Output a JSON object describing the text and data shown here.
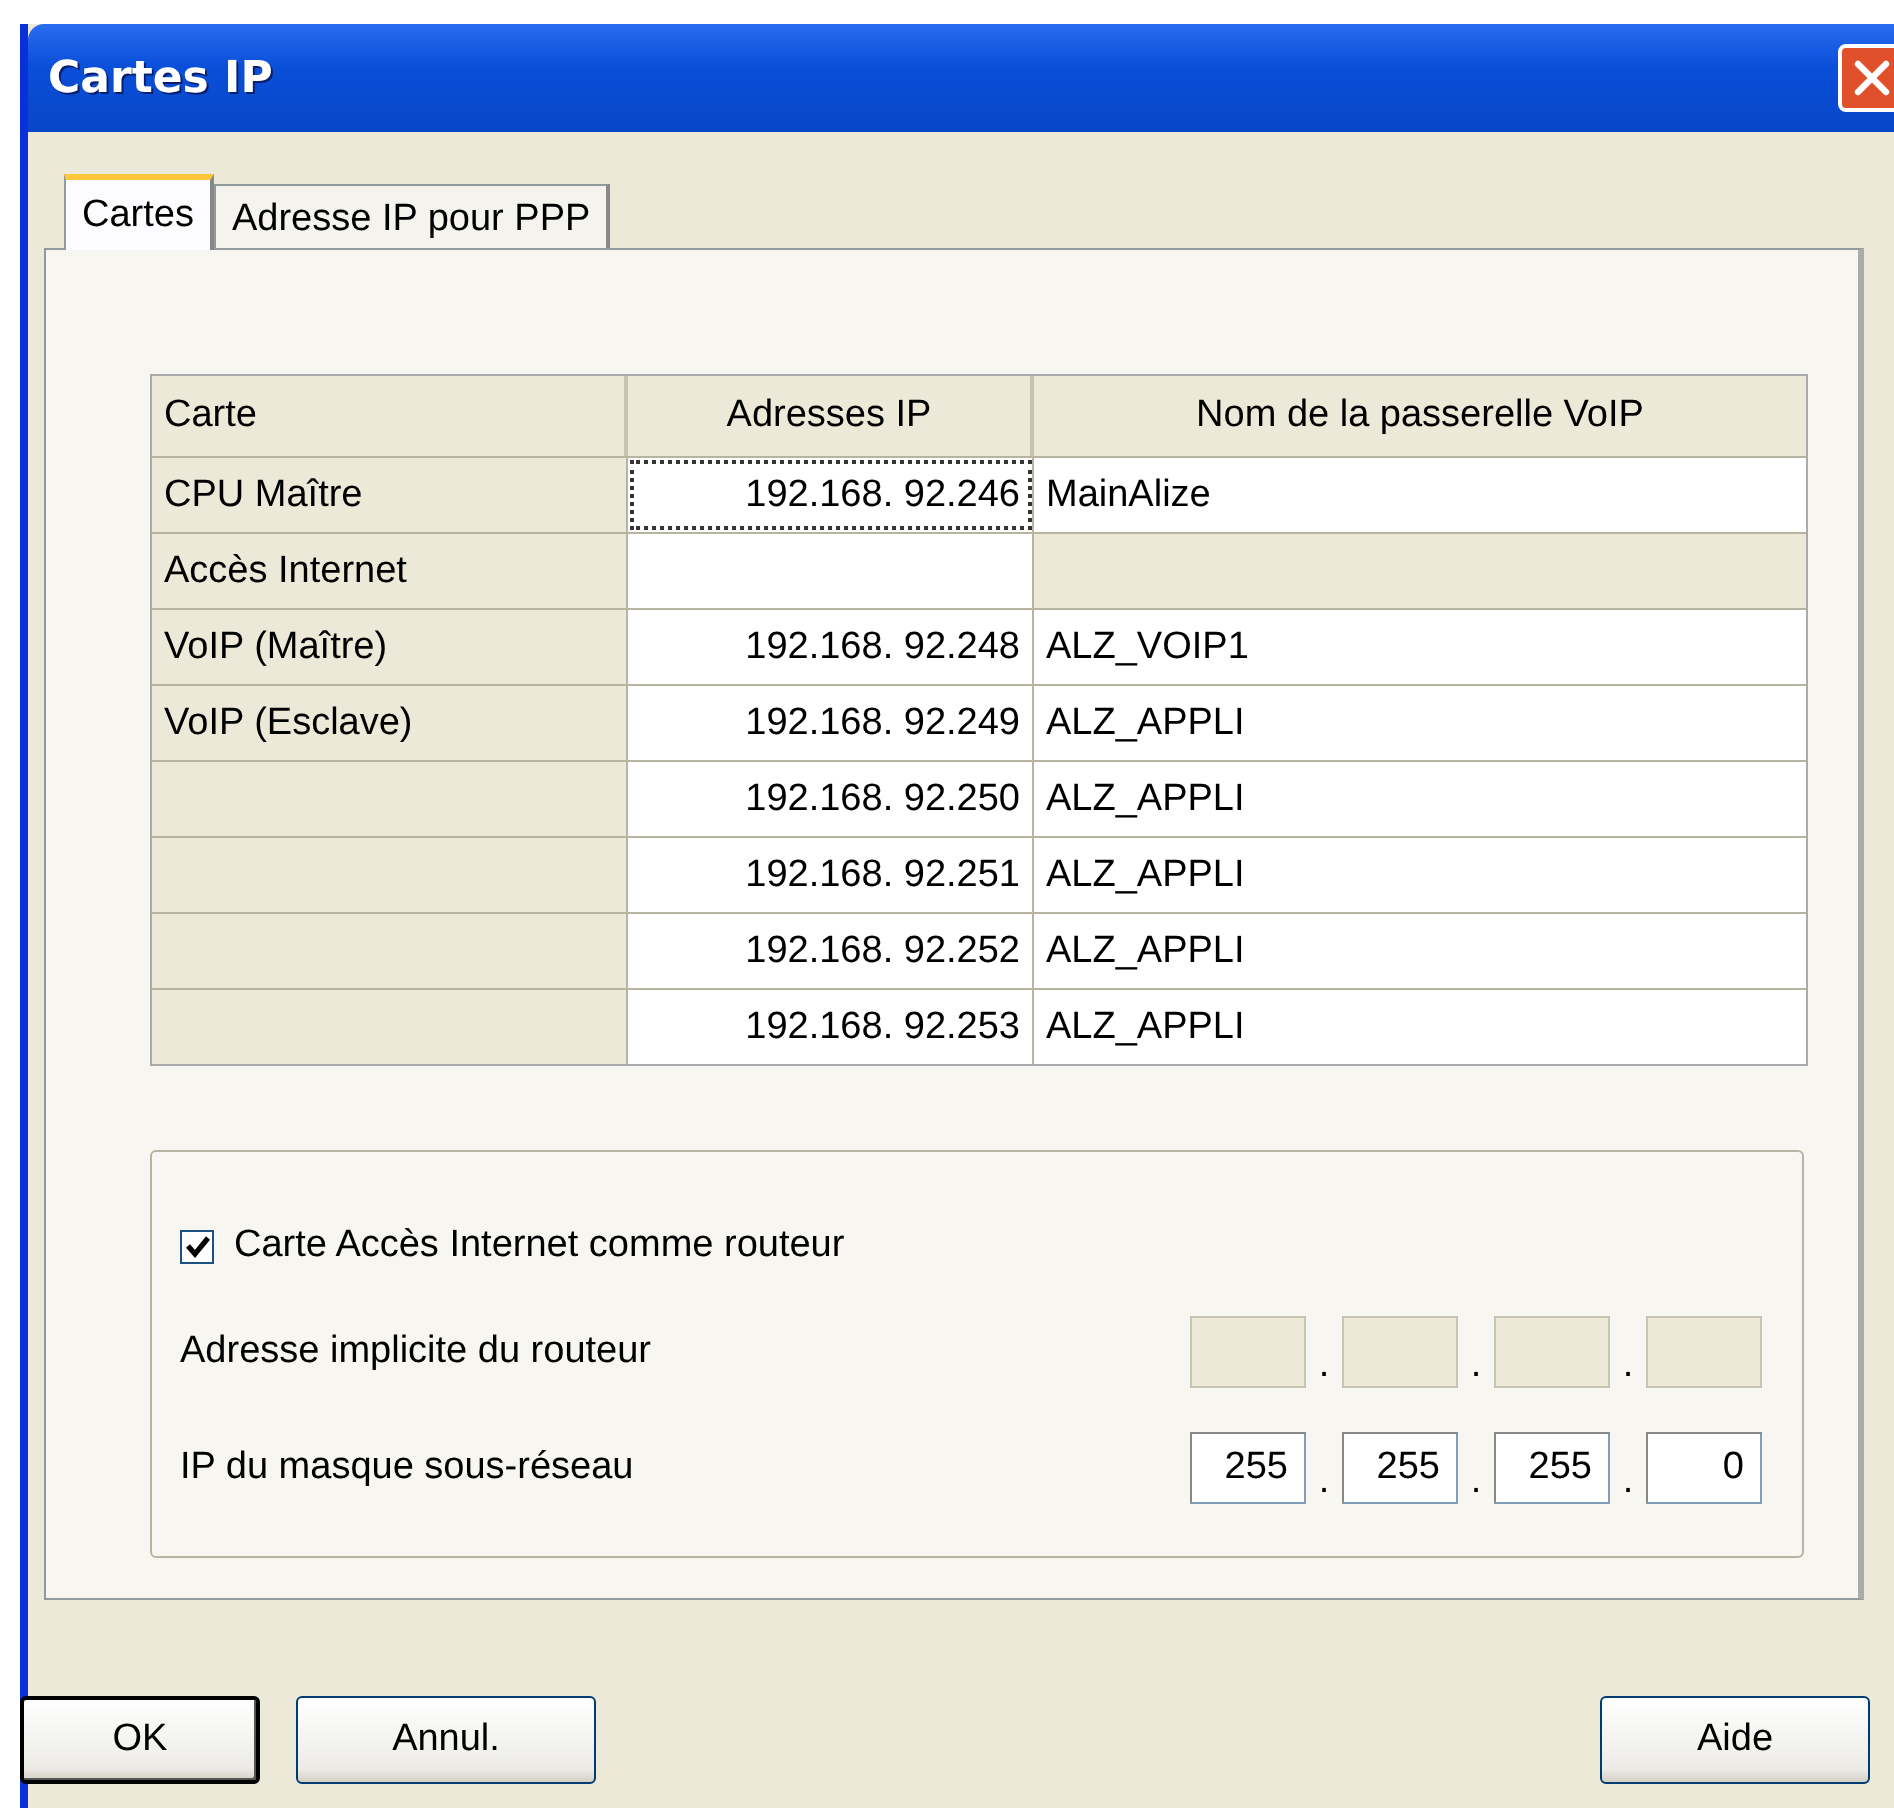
{
  "window": {
    "title": "Cartes IP"
  },
  "tabs": [
    {
      "label": "Cartes",
      "selected": true
    },
    {
      "label": "Adresse IP pour PPP",
      "selected": false
    }
  ],
  "table": {
    "columns": [
      "Carte",
      "Adresses IP",
      "Nom de la passerelle VoIP"
    ],
    "rows": [
      {
        "card": "CPU Maître",
        "ip": "192.168. 92.246",
        "gateway": "MainAlize",
        "focused": true,
        "gateway_disabled": false
      },
      {
        "card": "Accès Internet",
        "focused": false,
        "gateway_disabled": true
      },
      {
        "card": "VoIP (Maître)",
        "ip": "192.168. 92.248",
        "gateway": "ALZ_VOIP1",
        "focused": false,
        "gateway_disabled": false
      },
      {
        "card": "VoIP (Esclave)",
        "ip": "192.168. 92.249",
        "gateway": "ALZ_APPLI",
        "focused": false,
        "gateway_disabled": false
      },
      {
        "ip": "192.168. 92.250",
        "gateway": "ALZ_APPLI",
        "focused": false,
        "gateway_disabled": false
      },
      {
        "ip": "192.168. 92.251",
        "gateway": "ALZ_APPLI",
        "focused": false,
        "gateway_disabled": false
      },
      {
        "ip": "192.168. 92.252",
        "gateway": "ALZ_APPLI",
        "focused": false,
        "gateway_disabled": false
      },
      {
        "ip": "192.168. 92.253",
        "gateway": "ALZ_APPLI",
        "focused": false,
        "gateway_disabled": false
      }
    ]
  },
  "router": {
    "checkbox": {
      "label": "Carte Accès Internet comme routeur",
      "checked": true
    },
    "addresses": [
      {
        "label": "Adresse implicite du routeur",
        "disabled": true,
        "separators": [
          ".",
          ".",
          "."
        ]
      },
      {
        "label": "IP du masque sous-réseau",
        "disabled": false,
        "octets": [
          "255",
          "255",
          "255",
          "0"
        ],
        "separators": [
          ".",
          ".",
          "."
        ]
      }
    ]
  },
  "buttons": [
    {
      "label": "OK",
      "default": true
    },
    {
      "label": "Annul.",
      "default": false
    },
    {
      "label": "Aide",
      "default": false
    }
  ]
}
